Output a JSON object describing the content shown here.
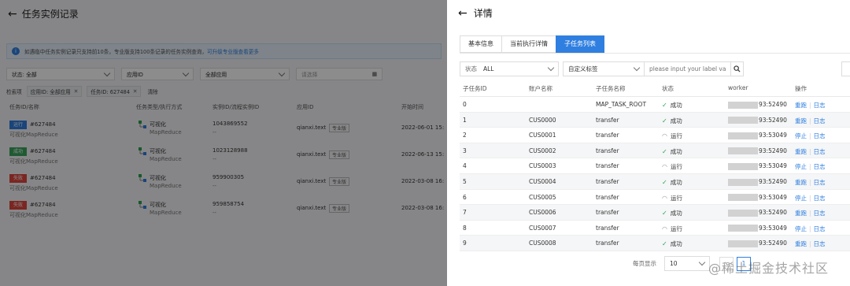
{
  "left_page": {
    "title": "任务实例记录",
    "notice": "如遇临中任务实例记录只支持前10条，专业版支持100条记录的任务实例查询，",
    "notice_link": "可升级专业版查看更多",
    "filters": [
      {
        "label": "状态:",
        "value": "全部"
      },
      {
        "label": "",
        "value": "应用ID"
      },
      {
        "label": "",
        "value": "全部应用"
      },
      {
        "label": "",
        "value": "请选择"
      }
    ],
    "tags_label": "检索项",
    "tags": [
      "应用ID: 全部应用",
      "任务ID: 627484"
    ],
    "clear": "清除",
    "columns": [
      "任务ID/名称",
      "任务类型/执行方式",
      "实例ID/流程实例ID",
      "应用ID",
      "开始时间"
    ],
    "rows": [
      {
        "badge": "运行",
        "badge_color": "#2f7fe0",
        "id": "#627484",
        "name": "可视化MapReduce",
        "type": "可视化",
        "exec": "MapReduce",
        "instance": "1043869552",
        "flow": "--",
        "app": "qianxi.text",
        "edition": "专业版",
        "start": "2022-06-01 15:"
      },
      {
        "badge": "成功",
        "badge_color": "#3aa55b",
        "id": "#627484",
        "name": "可视化MapReduce",
        "type": "可视化",
        "exec": "MapReduce",
        "instance": "1023128988",
        "flow": "--",
        "app": "qianxi.text",
        "edition": "专业版",
        "start": "2022-06-13 15:"
      },
      {
        "badge": "失败",
        "badge_color": "#e0463c",
        "id": "#627484",
        "name": "可视化MapReduce",
        "type": "可视化",
        "exec": "MapReduce",
        "instance": "959900305",
        "flow": "--",
        "app": "qianxi.text",
        "edition": "专业版",
        "start": "2022-03-08 16:"
      },
      {
        "badge": "失败",
        "badge_color": "#e0463c",
        "id": "#627484",
        "name": "可视化MapReduce",
        "type": "可视化",
        "exec": "MapReduce",
        "instance": "959858754",
        "flow": "--",
        "app": "qianxi.text",
        "edition": "专业版",
        "start": "2022-03-08 16:"
      }
    ]
  },
  "drawer": {
    "title": "详情",
    "tabs": [
      "基本信息",
      "当前执行详情",
      "子任务列表"
    ],
    "active_tab": 2,
    "status_label": "状态",
    "status_value": "ALL",
    "tag_select": "自定义标签",
    "label_placeholder": "please input your label valu",
    "columns": [
      "子任务ID",
      "账户名称",
      "子任务名称",
      "状态",
      "worker",
      "操作"
    ],
    "rows": [
      {
        "id": "0",
        "account": "",
        "name": "MAP_TASK_ROOT",
        "status": "成功",
        "kind": "ok",
        "port": "93:52490",
        "actions": [
          "重跑",
          "日志"
        ]
      },
      {
        "id": "1",
        "account": "CUS0000",
        "name": "transfer",
        "status": "成功",
        "kind": "ok",
        "port": "93:52490",
        "actions": [
          "重跑",
          "日志"
        ]
      },
      {
        "id": "2",
        "account": "CUS0001",
        "name": "transfer",
        "status": "运行",
        "kind": "run",
        "port": "93:53049",
        "actions": [
          "停止",
          "日志"
        ]
      },
      {
        "id": "3",
        "account": "CUS0002",
        "name": "transfer",
        "status": "成功",
        "kind": "ok",
        "port": "93:52490",
        "actions": [
          "重跑",
          "日志"
        ]
      },
      {
        "id": "4",
        "account": "CUS0003",
        "name": "transfer",
        "status": "运行",
        "kind": "run",
        "port": "93:53049",
        "actions": [
          "停止",
          "日志"
        ]
      },
      {
        "id": "5",
        "account": "CUS0004",
        "name": "transfer",
        "status": "成功",
        "kind": "ok",
        "port": "93:52490",
        "actions": [
          "重跑",
          "日志"
        ]
      },
      {
        "id": "6",
        "account": "CUS0005",
        "name": "transfer",
        "status": "运行",
        "kind": "run",
        "port": "93:53049",
        "actions": [
          "停止",
          "日志"
        ]
      },
      {
        "id": "7",
        "account": "CUS0006",
        "name": "transfer",
        "status": "成功",
        "kind": "ok",
        "port": "93:52490",
        "actions": [
          "重跑",
          "日志"
        ]
      },
      {
        "id": "8",
        "account": "CUS0007",
        "name": "transfer",
        "status": "运行",
        "kind": "run",
        "port": "93:53049",
        "actions": [
          "停止",
          "日志"
        ]
      },
      {
        "id": "9",
        "account": "CUS0008",
        "name": "transfer",
        "status": "成功",
        "kind": "ok",
        "port": "93:52490",
        "actions": [
          "重跑",
          "日志"
        ]
      }
    ],
    "pager": {
      "label": "每页显示",
      "page_size": "10",
      "current_page": "1"
    }
  },
  "watermark": "@稀土掘金技术社区",
  "colors": {
    "accent": "#2f7fe0",
    "success": "#2aa34b",
    "danger": "#e0463c"
  }
}
